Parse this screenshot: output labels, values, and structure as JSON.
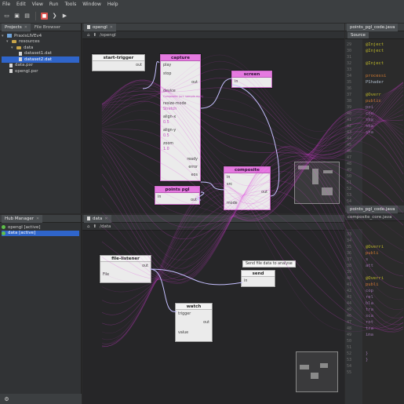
{
  "menu": {
    "items": [
      "File",
      "Edit",
      "View",
      "Run",
      "Tools",
      "Window",
      "Help"
    ]
  },
  "toolbar": {
    "icons": [
      "open-icon",
      "save-icon",
      "save-all-icon",
      "stop-icon",
      "step-icon",
      "run-icon"
    ]
  },
  "projects_panel": {
    "tabs": [
      {
        "label": "Projects",
        "active": true
      },
      {
        "label": "File Browser",
        "active": false
      }
    ],
    "tree": [
      {
        "label": "PraxisLIVEv4",
        "indent": 0,
        "icon": "project-icon",
        "selected": false
      },
      {
        "label": "resources",
        "indent": 1,
        "icon": "folder-icon",
        "selected": false
      },
      {
        "label": "data",
        "indent": 2,
        "icon": "folder-icon",
        "selected": false
      },
      {
        "label": "dataset1.dat",
        "indent": 3,
        "icon": "file-icon",
        "selected": false
      },
      {
        "label": "dataset2.dat",
        "indent": 3,
        "icon": "file-icon",
        "selected": true
      },
      {
        "label": "data.pxr",
        "indent": 1,
        "icon": "file-icon",
        "selected": false
      },
      {
        "label": "opengl.pxr",
        "indent": 1,
        "icon": "file-icon",
        "selected": false
      }
    ]
  },
  "hub_panel": {
    "tab": "Hub Manager",
    "items": [
      {
        "label": "opengl [active]",
        "selected": false
      },
      {
        "label": "data [active]",
        "selected": true
      }
    ]
  },
  "graph_top": {
    "tab": "opengl",
    "crumb": "/opengl",
    "nodes": {
      "start_trigger": {
        "title": "start-trigger",
        "ports": [
          "out"
        ]
      },
      "capture": {
        "title": "capture",
        "ports": [
          "play",
          "stop",
          "out",
          "device",
          "Composite (uri: sample.mp4)",
          "resize-mode",
          "Stretch",
          "align-x",
          "0.5",
          "align-y",
          "0.5",
          "zoom",
          "1.0",
          "ready",
          "error",
          "eos",
          "out"
        ]
      },
      "screen": {
        "title": "screen",
        "ports": [
          "in"
        ]
      },
      "composite": {
        "title": "composite",
        "ports": [
          "in",
          "src",
          "out",
          "mode"
        ]
      },
      "points_pgl": {
        "title": "points pgl",
        "ports": [
          "in",
          "out"
        ]
      }
    }
  },
  "graph_bottom": {
    "tab": "data",
    "crumb": "/data",
    "tooltip": "Send file data to analyse",
    "nodes": {
      "file_listener": {
        "title": "file-listener",
        "ports": [
          "out",
          "File"
        ]
      },
      "send": {
        "title": "send",
        "ports": [
          "in"
        ]
      },
      "watch": {
        "title": "watch",
        "ports": [
          "trigger",
          "out",
          "value"
        ]
      }
    }
  },
  "source_top": {
    "tab": "points_pgl_code.java",
    "subtab": "Source",
    "line_numbers": [
      "29",
      "30",
      "31",
      "32",
      "33",
      "34",
      "35",
      "36",
      "37",
      "38",
      "39",
      "40",
      "41",
      "42",
      "43",
      "44",
      "45",
      "46",
      "47",
      "48",
      "49",
      "50",
      "51",
      "52",
      "53",
      "54",
      "55"
    ],
    "lines": [
      "@Inject",
      "@Inject",
      "",
      "@Inject",
      "",
      "processi",
      "PShader",
      "",
      "@Overr",
      "public",
      "   poi",
      "   cou",
      "   sha",
      "   sha",
      "   sha",
      "",
      "",
      "",
      "",
      "",
      "",
      "",
      "",
      "",
      "",
      "",
      ""
    ]
  },
  "source_bottom": {
    "tab": "points_pgl_code.java",
    "tab2": "composite_core.java",
    "subtab": "Source",
    "line_numbers": [
      "33",
      "34",
      "35",
      "36",
      "37",
      "38",
      "39",
      "40",
      "41",
      "42",
      "43",
      "44",
      "45",
      "46",
      "47",
      "48",
      "49",
      "50",
      "51",
      "52",
      "53",
      "54",
      "55"
    ],
    "lines": [
      "",
      "",
      "@Overri",
      "publi",
      "   s",
      "   att",
      "",
      "@Overri",
      "publi",
      "   cop",
      "   rel",
      "   bla",
      "   tra",
      "   sca",
      "   rot",
      "   tra",
      "   ima",
      "",
      "",
      "}",
      "}",
      "",
      ""
    ]
  },
  "colors": {
    "accent": "#e040e0",
    "selection": "#2f65ca",
    "node_pink": "#e57ae0"
  }
}
